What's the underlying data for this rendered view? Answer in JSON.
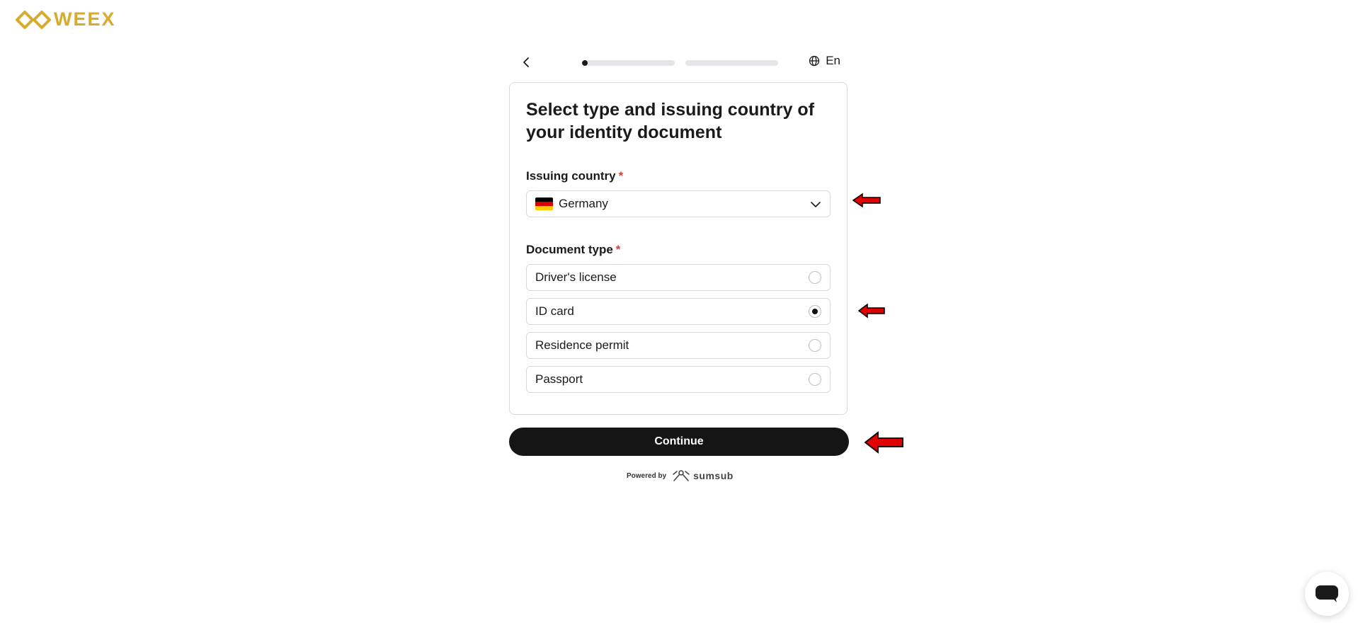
{
  "brand": {
    "name": "WEEX",
    "color": "#d7ab2b"
  },
  "topbar": {
    "back_icon": "chevron-left-icon",
    "progress": [
      {
        "fraction": 0.06
      },
      {
        "fraction": 0.0
      }
    ],
    "language_icon": "globe-icon",
    "language_label": "En"
  },
  "card": {
    "title": "Select type and issuing country of your identity document",
    "country": {
      "label": "Issuing country",
      "required_mark": "*",
      "selected_value": "Germany",
      "flag_colors": [
        "#000000",
        "#dd0000",
        "#ffce00"
      ]
    },
    "document_type": {
      "label": "Document type",
      "required_mark": "*",
      "options": [
        {
          "label": "Driver's license",
          "selected": false
        },
        {
          "label": "ID card",
          "selected": true
        },
        {
          "label": "Residence permit",
          "selected": false
        },
        {
          "label": "Passport",
          "selected": false
        }
      ]
    }
  },
  "continue_label": "Continue",
  "footer": {
    "powered_by": "Powered by",
    "provider": "sumsub"
  },
  "annotations": {
    "arrow_color": "#e00000"
  },
  "chat_icon": "chat-bubble-icon"
}
